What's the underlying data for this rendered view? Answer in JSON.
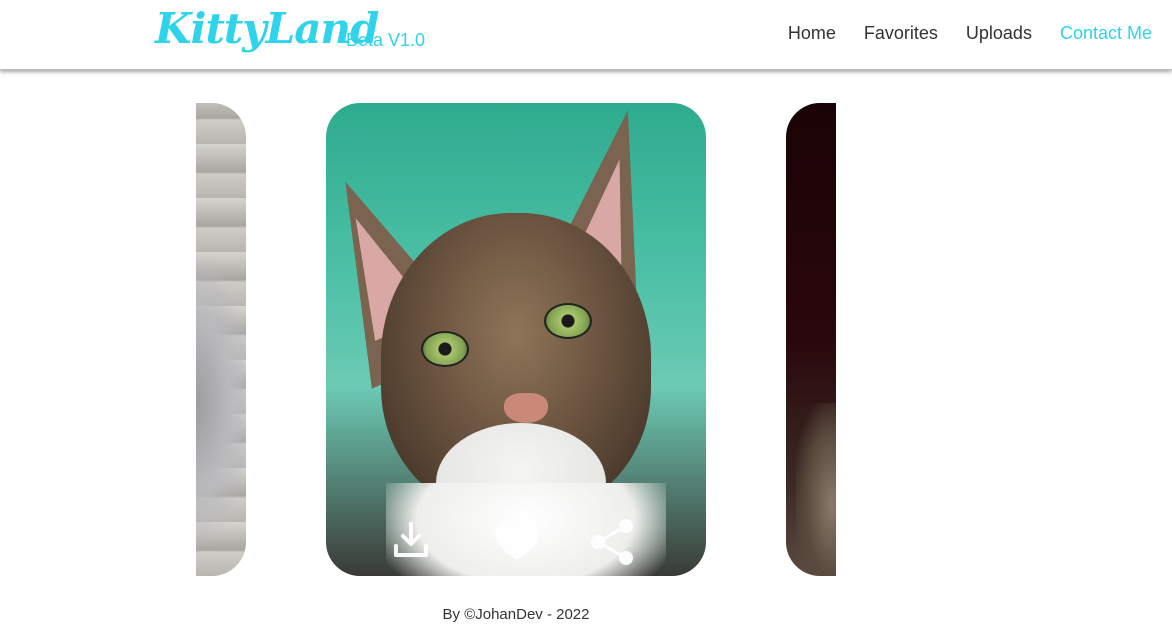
{
  "header": {
    "logo": "KittyLand",
    "version": "Beta V1.0",
    "nav": [
      {
        "label": "Home",
        "active": false
      },
      {
        "label": "Favorites",
        "active": false
      },
      {
        "label": "Uploads",
        "active": false
      },
      {
        "label": "Contact Me",
        "active": true
      }
    ],
    "accent_color": "#2fd3ea"
  },
  "carousel": {
    "cards": [
      {
        "position": "previous",
        "subject": "gray-long-haired-cat-photo"
      },
      {
        "position": "current",
        "subject": "tabby-kitten-photo"
      },
      {
        "position": "next",
        "subject": "dark-cat-photo"
      }
    ],
    "actions": [
      {
        "icon": "download-icon"
      },
      {
        "icon": "heart-icon"
      },
      {
        "icon": "share-icon"
      }
    ]
  },
  "footer": {
    "text": "By ©JohanDev - 2022"
  }
}
